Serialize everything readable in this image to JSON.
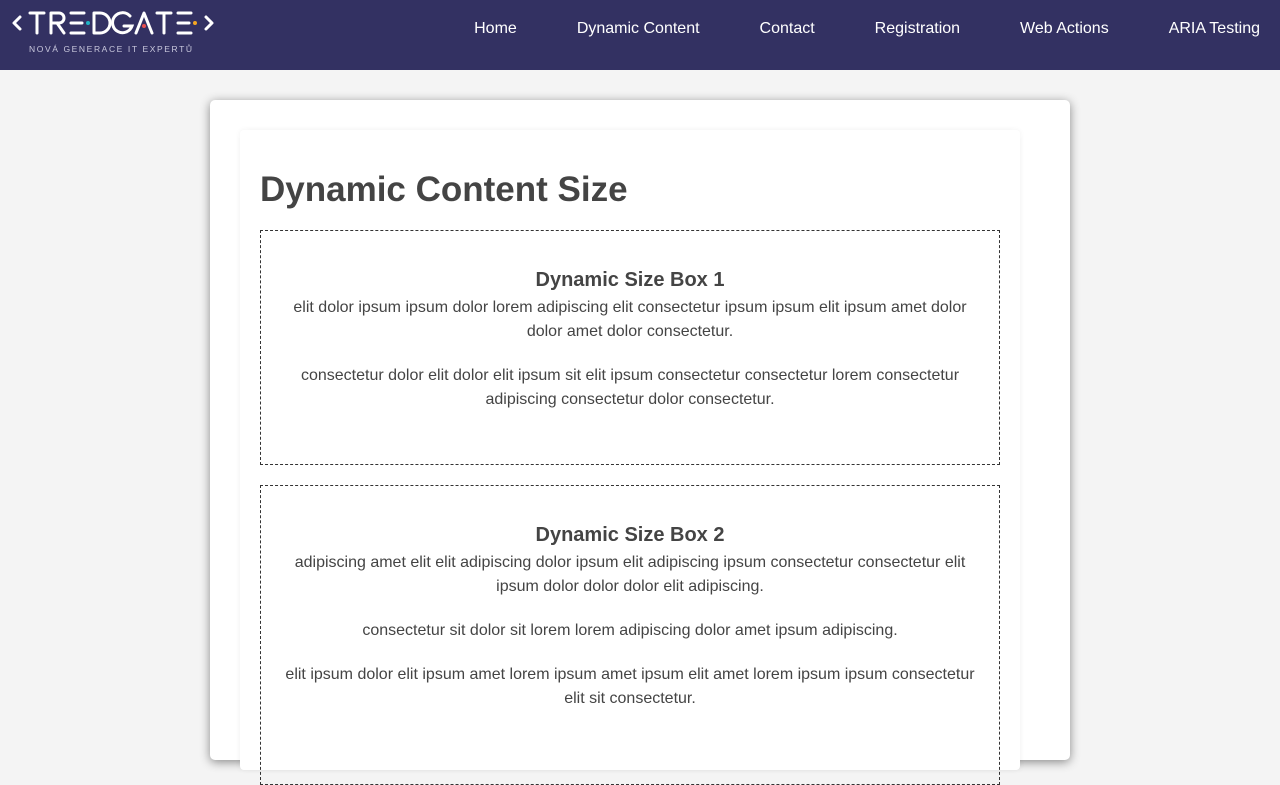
{
  "header": {
    "logo": {
      "text": "TREDGATE",
      "tagline": "NOVÁ GENERACE IT EXPERTŮ"
    },
    "nav": [
      "Home",
      "Dynamic Content",
      "Contact",
      "Registration",
      "Web Actions",
      "ARIA Testing"
    ]
  },
  "colors": {
    "navbar": "#333162",
    "page_background": "#f4f4f4",
    "text": "#444444",
    "logo_accents": [
      "#e94f4f",
      "#1fb3c4",
      "#f5a623"
    ]
  },
  "main": {
    "title": "Dynamic Content Size",
    "boxes": [
      {
        "title": "Dynamic Size Box 1",
        "paragraphs": [
          "elit dolor ipsum ipsum dolor lorem adipiscing elit consectetur ipsum ipsum elit ipsum amet dolor dolor amet dolor consectetur.",
          "consectetur dolor elit dolor elit ipsum sit elit ipsum consectetur consectetur lorem consectetur adipiscing consectetur dolor consectetur."
        ]
      },
      {
        "title": "Dynamic Size Box 2",
        "paragraphs": [
          "adipiscing amet elit elit adipiscing dolor ipsum elit adipiscing ipsum consectetur consectetur elit ipsum dolor dolor dolor elit adipiscing.",
          "consectetur sit dolor sit lorem lorem adipiscing dolor amet ipsum adipiscing.",
          "elit ipsum dolor elit ipsum amet lorem ipsum amet ipsum elit amet lorem ipsum ipsum consectetur elit sit consectetur."
        ]
      }
    ]
  }
}
